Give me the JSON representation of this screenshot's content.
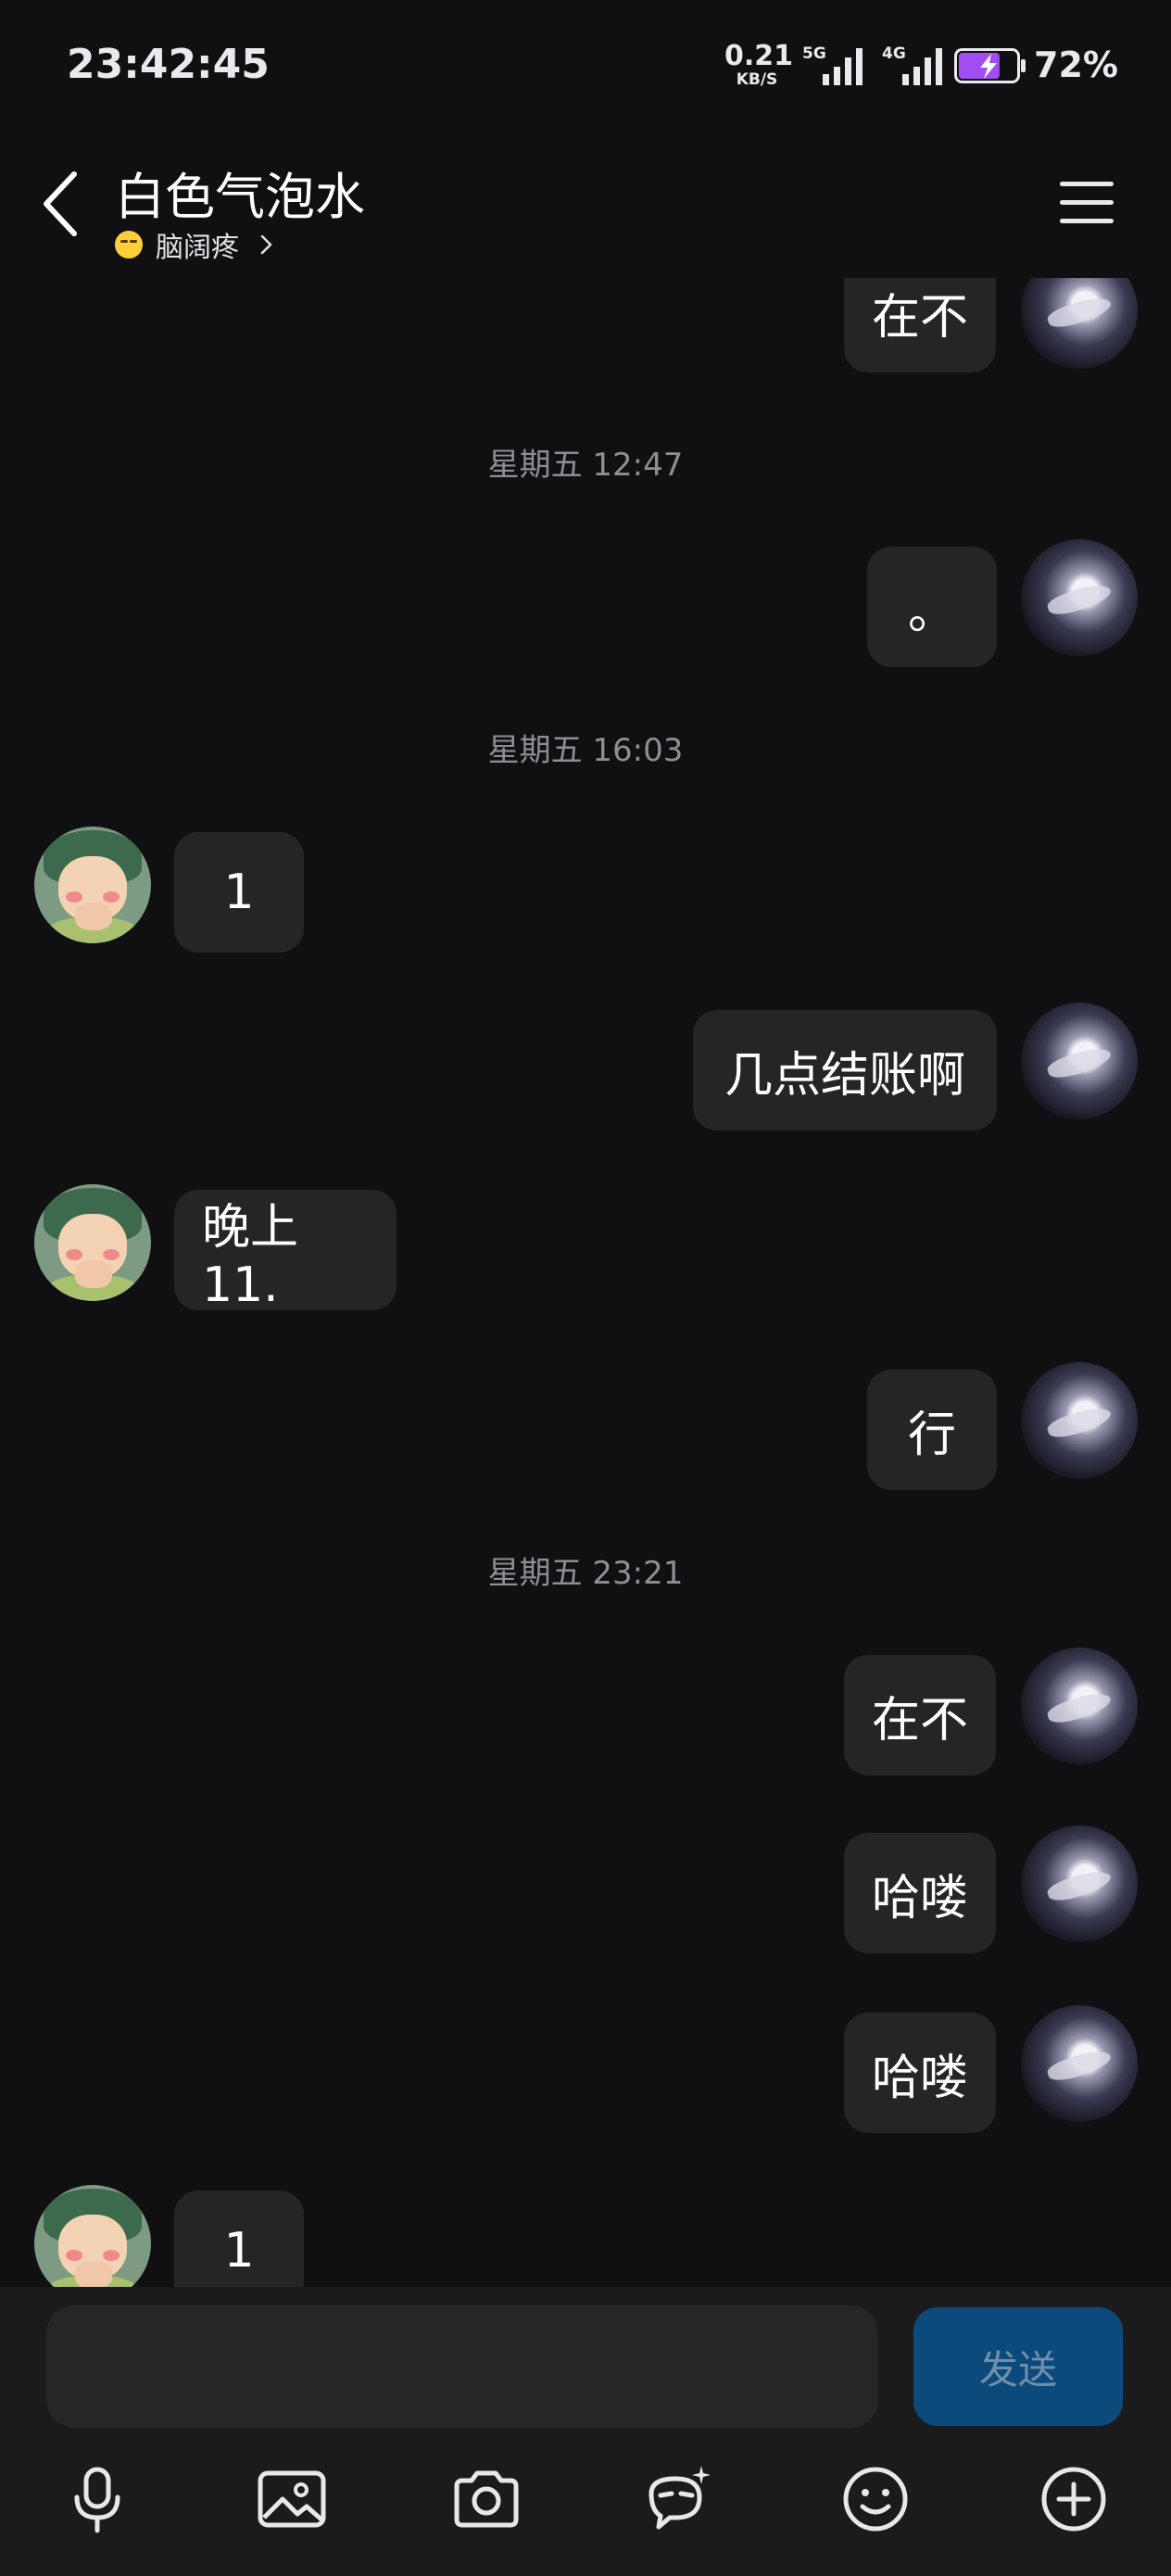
{
  "status_bar": {
    "time": "23:42:45",
    "net_speed": "0.21",
    "net_speed_unit": "KB/S",
    "sim1_type": "5G",
    "sim2_type": "4G",
    "battery_percent": "72%",
    "battery_level": 0.72,
    "battery_charging": true
  },
  "header": {
    "title": "白色气泡水",
    "status_icon": "squinting-face-icon",
    "status_text": "脑阔疼"
  },
  "messages": [
    {
      "side": "me",
      "text": "在不"
    },
    {
      "timestamp": "星期五 12:47"
    },
    {
      "side": "me",
      "text": "。"
    },
    {
      "timestamp": "星期五 16:03"
    },
    {
      "side": "them",
      "text": "1"
    },
    {
      "side": "me",
      "text": "几点结账啊"
    },
    {
      "side": "them",
      "text": "晚上11."
    },
    {
      "side": "me",
      "text": "行"
    },
    {
      "timestamp": "星期五 23:21"
    },
    {
      "side": "me",
      "text": "在不"
    },
    {
      "side": "me",
      "text": "哈喽"
    },
    {
      "side": "me",
      "text": "哈喽"
    },
    {
      "side": "them",
      "text": "1"
    }
  ],
  "input": {
    "value": "",
    "placeholder": "",
    "send_label": "发送"
  },
  "toolbar": [
    "microphone-icon",
    "image-icon",
    "camera-icon",
    "magic-bubble-icon",
    "smiley-icon",
    "plus-circle-icon"
  ],
  "colors": {
    "background": "#101013",
    "bubble": "#252528",
    "send_button": "#0b4a7a",
    "timestamp_text": "#8e8e95",
    "battery_fill": "#a24cf3"
  }
}
